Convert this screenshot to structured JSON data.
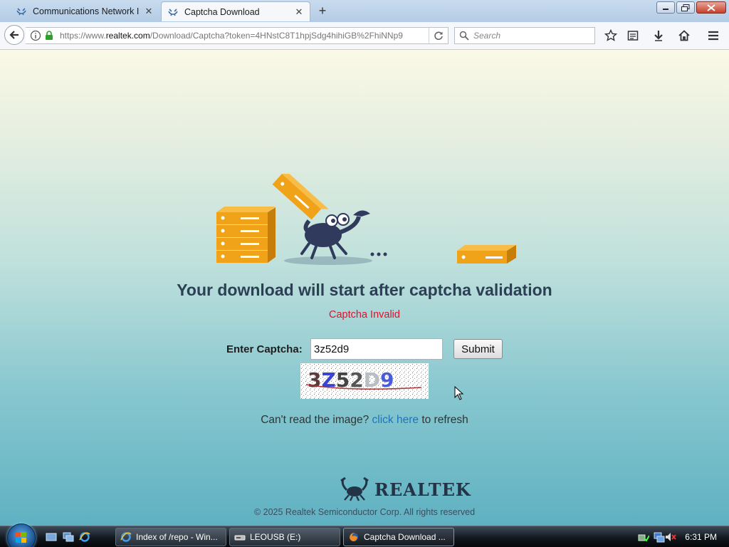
{
  "browser": {
    "tabs": [
      {
        "title": "Communications Network I",
        "active": false
      },
      {
        "title": "Captcha Download",
        "active": true
      }
    ],
    "url": {
      "prefix": "https://www.",
      "domain": "realtek.com",
      "path": "/Download/Captcha?token=4HNstC8T1hpjSdg4hihiGB%2FhiNNp9"
    },
    "search_placeholder": "Search"
  },
  "page": {
    "headline": "Your download will start after captcha validation",
    "error": "Captcha Invalid",
    "captcha_label": "Enter Captcha:",
    "captcha_value": "3z52d9",
    "submit_label": "Submit",
    "captcha_image_text": "3Z52D9",
    "refresh_prefix": "Can't read the image?",
    "refresh_link": "click here",
    "refresh_suffix": "to refresh",
    "logo_text": "REALTEK",
    "copyright": "© 2025 Realtek Semiconductor Corp. All rights reserved"
  },
  "taskbar": {
    "items": [
      {
        "label": "Index of /repo - Win...",
        "active": false
      },
      {
        "label": "LEOUSB (E:)",
        "active": false
      },
      {
        "label": "Captcha Download ...",
        "active": true
      }
    ],
    "clock": "6:31 PM"
  },
  "colors": {
    "error": "#e0112b",
    "link": "#1e73be",
    "heading": "#2d3f54",
    "box": "#f0a318"
  }
}
